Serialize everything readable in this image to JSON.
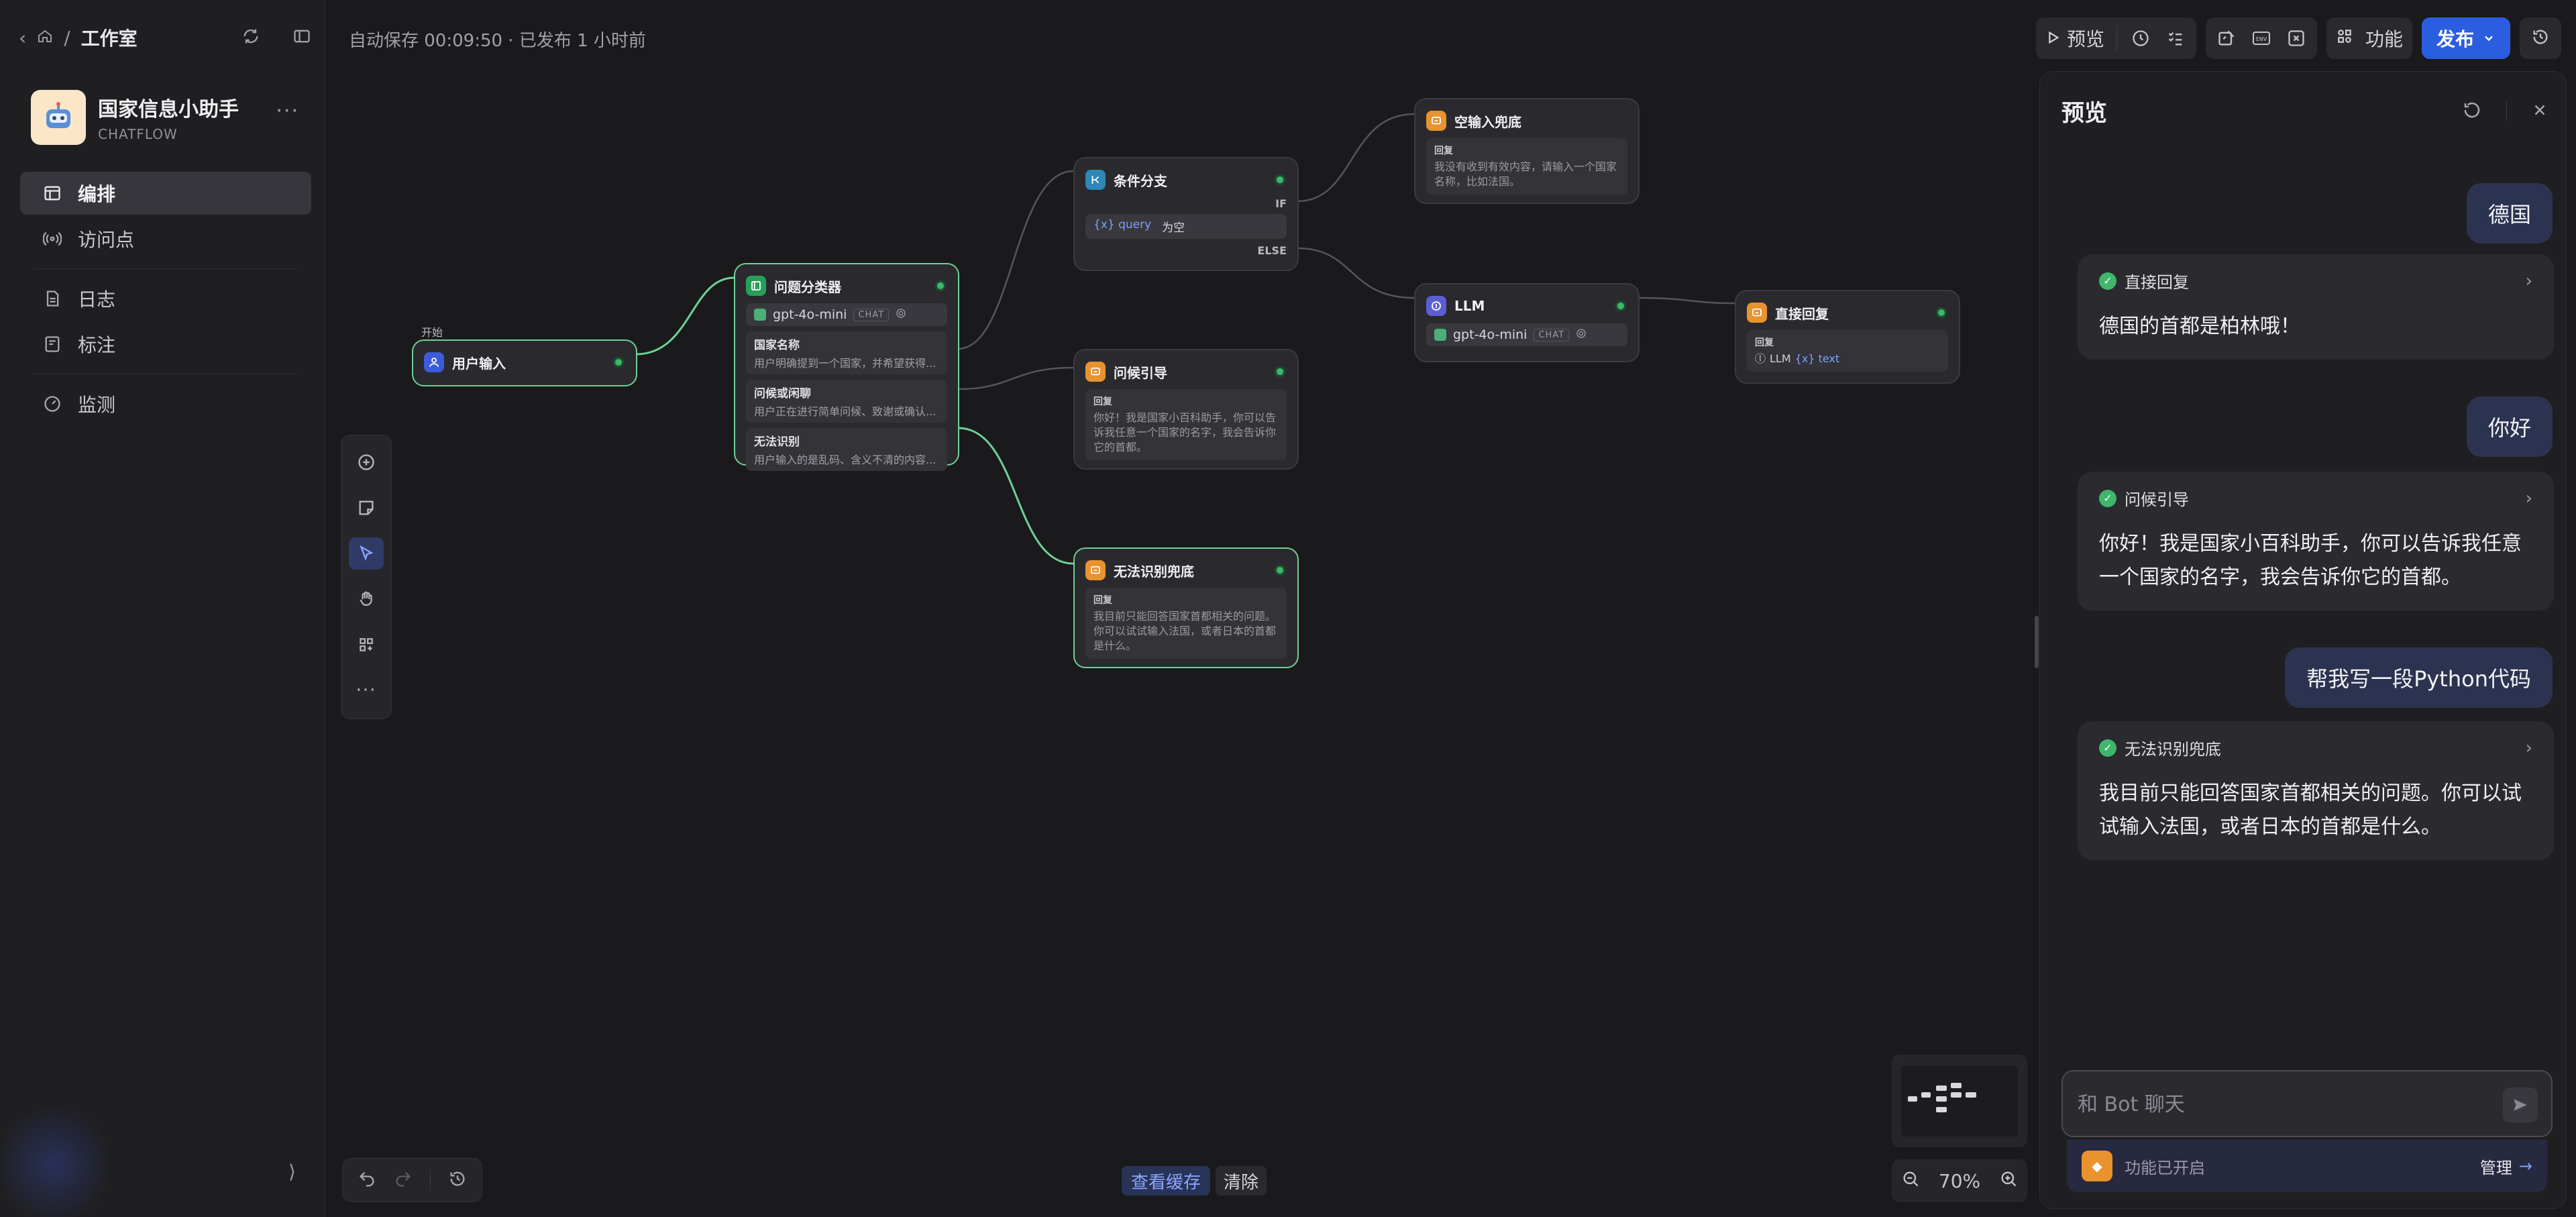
{
  "breadcrumb": {
    "home_sep": "/",
    "title": "工作室"
  },
  "app": {
    "name": "国家信息小助手",
    "type": "CHATFLOW",
    "more": "···"
  },
  "nav": {
    "items": [
      {
        "label": "编排",
        "icon": "layout-icon",
        "active": true
      },
      {
        "label": "访问点",
        "icon": "broadcast-icon"
      },
      {
        "label": "日志",
        "icon": "document-icon"
      },
      {
        "label": "标注",
        "icon": "bookmark-icon"
      },
      {
        "label": "监测",
        "icon": "gauge-icon"
      }
    ],
    "collapse": "⟩"
  },
  "status": {
    "autosave": "自动保存 00:09:50 · 已发布 1 小时前"
  },
  "toolbar": {
    "preview": "预览",
    "features": "功能",
    "publish": "发布"
  },
  "nodes": {
    "start": {
      "label": "开始",
      "title": "用户输入"
    },
    "classifier": {
      "title": "问题分类器",
      "model": "gpt-4o-mini",
      "model_tag": "CHAT",
      "classes": [
        {
          "title": "国家名称",
          "desc": "用户明确提到一个国家，并希望获得..."
        },
        {
          "title": "问候或闲聊",
          "desc": "用户正在进行简单问候、致谢或确认..."
        },
        {
          "title": "无法识别",
          "desc": "用户输入的是乱码、含义不清的内容..."
        }
      ]
    },
    "branch": {
      "title": "条件分支",
      "if": "IF",
      "var": "{x} query",
      "op": "为空",
      "else": "ELSE"
    },
    "greet": {
      "title": "问候引导",
      "reply_label": "回复",
      "reply": "你好！我是国家小百科助手，你可以告诉我任意一个国家的名字，我会告诉你它的首都。"
    },
    "fallback": {
      "title": "无法识别兜底",
      "reply_label": "回复",
      "reply": "我目前只能回答国家首都相关的问题。你可以试试输入法国，或者日本的首都是什么。"
    },
    "empty": {
      "title": "空输入兜底",
      "reply_label": "回复",
      "reply": "我没有收到有效内容，请输入一个国家名称，比如法国。"
    },
    "llm": {
      "title": "LLM",
      "model": "gpt-4o-mini",
      "model_tag": "CHAT"
    },
    "direct": {
      "title": "直接回复",
      "reply_label": "回复",
      "ref_node": "LLM",
      "ref_var": "{x} text"
    }
  },
  "canvas_bottom": {
    "view_cache": "查看缓存",
    "clear": "清除",
    "zoom": "70%"
  },
  "preview": {
    "title": "预览",
    "messages": [
      {
        "role": "user",
        "text": "德国"
      },
      {
        "role": "bot",
        "node": "直接回复",
        "text": "德国的首都是柏林哦！"
      },
      {
        "role": "user",
        "text": "你好"
      },
      {
        "role": "bot",
        "node": "问候引导",
        "text": "你好！我是国家小百科助手，你可以告诉我任意一个国家的名字，我会告诉你它的首都。"
      },
      {
        "role": "user",
        "text": "帮我写一段Python代码"
      },
      {
        "role": "bot",
        "node": "无法识别兜底",
        "text": "我目前只能回答国家首都相关的问题。你可以试试输入法国，或者日本的首都是什么。"
      }
    ],
    "input_placeholder": "和 Bot 聊天",
    "features_status": "功能已开启",
    "manage": "管理"
  },
  "colors": {
    "accent": "#2a5de0",
    "success": "#3fb66b",
    "selected_edge": "#6fcf97"
  }
}
